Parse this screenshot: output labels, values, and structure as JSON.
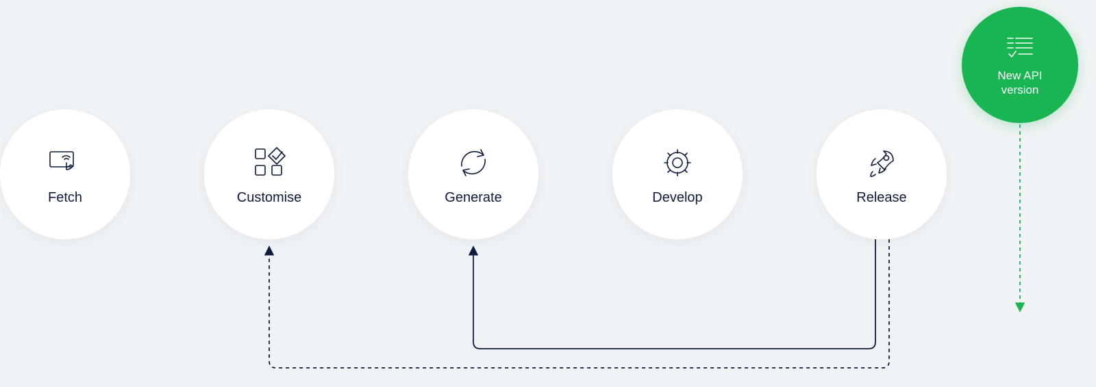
{
  "steps": [
    {
      "id": "fetch",
      "label": "Fetch"
    },
    {
      "id": "customise",
      "label": "Customise"
    },
    {
      "id": "generate",
      "label": "Generate"
    },
    {
      "id": "develop",
      "label": "Develop"
    },
    {
      "id": "release",
      "label": "Release"
    }
  ],
  "new_api": {
    "label": "New API\nversion"
  },
  "colors": {
    "accent": "#18b552",
    "ink": "#0d1b3d"
  }
}
